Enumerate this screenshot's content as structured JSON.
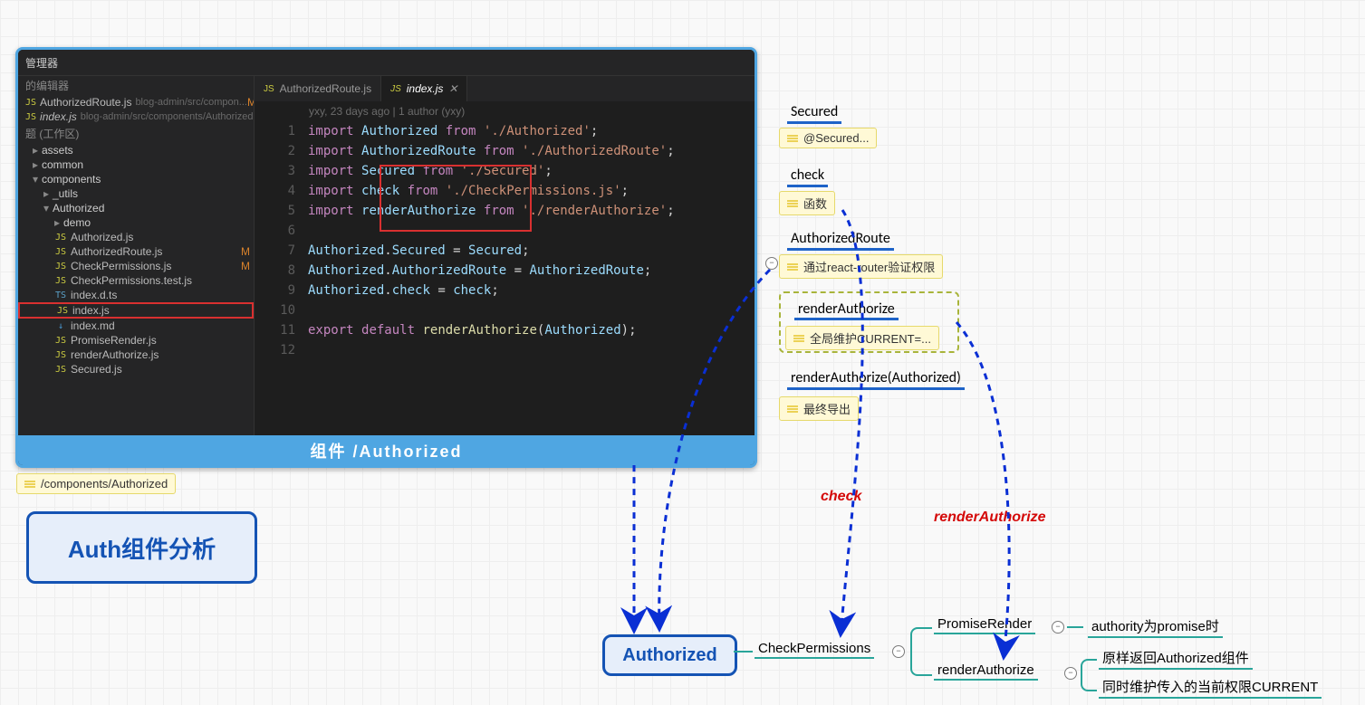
{
  "vscode": {
    "titlebar": "管理器",
    "subtitle": "的编辑器",
    "openEditors": [
      {
        "icon": "JS",
        "name": "AuthorizedRoute.js",
        "path": "blog-admin/src/compon...",
        "m": "M"
      },
      {
        "icon": "JS",
        "name": "index.js",
        "path": "blog-admin/src/components/Authorized",
        "italic": true,
        "m": ""
      }
    ],
    "workspaceLabel": "题 (工作区)",
    "tree": [
      {
        "type": "folder",
        "depth": 0,
        "open": false,
        "name": "assets"
      },
      {
        "type": "folder",
        "depth": 0,
        "open": false,
        "name": "common"
      },
      {
        "type": "folder",
        "depth": 0,
        "open": true,
        "name": "components"
      },
      {
        "type": "folder",
        "depth": 1,
        "open": false,
        "name": "_utils"
      },
      {
        "type": "folder",
        "depth": 1,
        "open": true,
        "name": "Authorized"
      },
      {
        "type": "folder",
        "depth": 2,
        "open": false,
        "name": "demo"
      },
      {
        "type": "file",
        "depth": 2,
        "icon": "JS",
        "name": "Authorized.js"
      },
      {
        "type": "file",
        "depth": 2,
        "icon": "JS",
        "name": "AuthorizedRoute.js",
        "m": "M"
      },
      {
        "type": "file",
        "depth": 2,
        "icon": "JS",
        "name": "CheckPermissions.js",
        "m": "M"
      },
      {
        "type": "file",
        "depth": 2,
        "icon": "JS",
        "name": "CheckPermissions.test.js"
      },
      {
        "type": "file",
        "depth": 2,
        "icon": "TS",
        "name": "index.d.ts"
      },
      {
        "type": "file",
        "depth": 2,
        "icon": "JS",
        "name": "index.js",
        "red": true
      },
      {
        "type": "file",
        "depth": 2,
        "icon": "↓",
        "name": "index.md"
      },
      {
        "type": "file",
        "depth": 2,
        "icon": "JS",
        "name": "PromiseRender.js"
      },
      {
        "type": "file",
        "depth": 2,
        "icon": "JS",
        "name": "renderAuthorize.js"
      },
      {
        "type": "file",
        "depth": 2,
        "icon": "JS",
        "name": "Secured.js"
      }
    ],
    "tabs": [
      {
        "name": "AuthorizedRoute.js",
        "active": false
      },
      {
        "name": "index.js",
        "active": true
      }
    ],
    "blame": "yxy, 23 days ago | 1 author (yxy)",
    "code": [
      {
        "n": 1,
        "h": "<span class='k'>import</span> <span class='id'>Authorized</span> <span class='k'>from</span> <span class='s'>'./Authorized'</span>;"
      },
      {
        "n": 2,
        "h": "<span class='k'>import</span> <span class='id'>AuthorizedRoute</span> <span class='k'>from</span> <span class='s'>'./AuthorizedRoute'</span>;"
      },
      {
        "n": 3,
        "h": "<span class='k'>import</span> <span class='id'>Secured</span> <span class='k'>from</span> <span class='s'>'./Secured'</span>;"
      },
      {
        "n": 4,
        "h": "<span class='k'>import</span> <span class='id'>check</span> <span class='k'>from</span> <span class='s'>'./CheckPermissions.js'</span>;"
      },
      {
        "n": 5,
        "h": "<span class='k'>import</span> <span class='id'>renderAuthorize</span> <span class='k'>from</span> <span class='s'>'./renderAuthorize'</span>;"
      },
      {
        "n": 6,
        "h": ""
      },
      {
        "n": 7,
        "h": "<span class='id'>Authorized</span>.<span class='id'>Secured</span> = <span class='id'>Secured</span>;"
      },
      {
        "n": 8,
        "h": "<span class='id'>Authorized</span>.<span class='id'>AuthorizedRoute</span> = <span class='id'>AuthorizedRoute</span>;"
      },
      {
        "n": 9,
        "h": "<span class='id'>Authorized</span>.<span class='id'>check</span> = <span class='id'>check</span>;"
      },
      {
        "n": 10,
        "h": ""
      },
      {
        "n": 11,
        "h": "<span class='k'>export</span> <span class='k'>default</span> <span class='fn'>renderAuthorize</span>(<span class='id'>Authorized</span>);"
      },
      {
        "n": 12,
        "h": ""
      }
    ],
    "footer": "组件     /Authorized"
  },
  "pathNote": "/components/Authorized",
  "authLabel": "Auth组件分析",
  "map": {
    "secured": {
      "title": "Secured",
      "note": "@Secured..."
    },
    "check": {
      "title": "check",
      "note": "函数"
    },
    "authRoute": {
      "title": "AuthorizedRoute",
      "note": "通过react-router验证权限"
    },
    "renderAuth": {
      "title": "renderAuthorize",
      "note": "全局维护CURRENT=..."
    },
    "renderAuthCall": {
      "title": "renderAuthorize(Authorized)",
      "note": "最终导出"
    }
  },
  "authorizedBox": "Authorized",
  "right": {
    "checkPermissions": "CheckPermissions",
    "promiseRender": "PromiseRender",
    "promiseRenderDetail": "authority为promise时",
    "renderAuthorize": "renderAuthorize",
    "renderAuthorizeD1": "原样返回Authorized组件",
    "renderAuthorizeD2": "同时维护传入的当前权限CURRENT"
  },
  "arrowLabels": {
    "check": "check",
    "renderAuthorize": "renderAuthorize"
  }
}
